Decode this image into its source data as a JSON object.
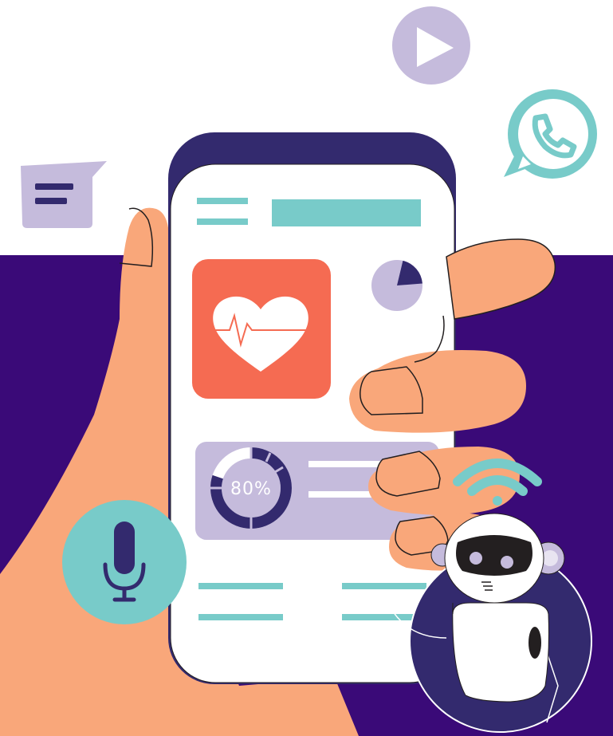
{
  "colors": {
    "background_top": "#ffffff",
    "background_bottom": "#3a0a78",
    "phone_frame": "#332a6e",
    "screen": "#ffffff",
    "accent_teal": "#78cbc9",
    "accent_lavender": "#c5bbdc",
    "heart_card": "#f56b52",
    "skin": "#f9a77a",
    "skin_outline": "#231f20"
  },
  "icons": [
    "chat-bubble-icon",
    "play-icon",
    "whatsapp-icon",
    "microphone-icon",
    "heart-icon",
    "wifi-icon",
    "robot-icon"
  ],
  "screen": {
    "pie_fraction": 0.2,
    "progress": {
      "label": "80%",
      "value": 0.8
    }
  }
}
